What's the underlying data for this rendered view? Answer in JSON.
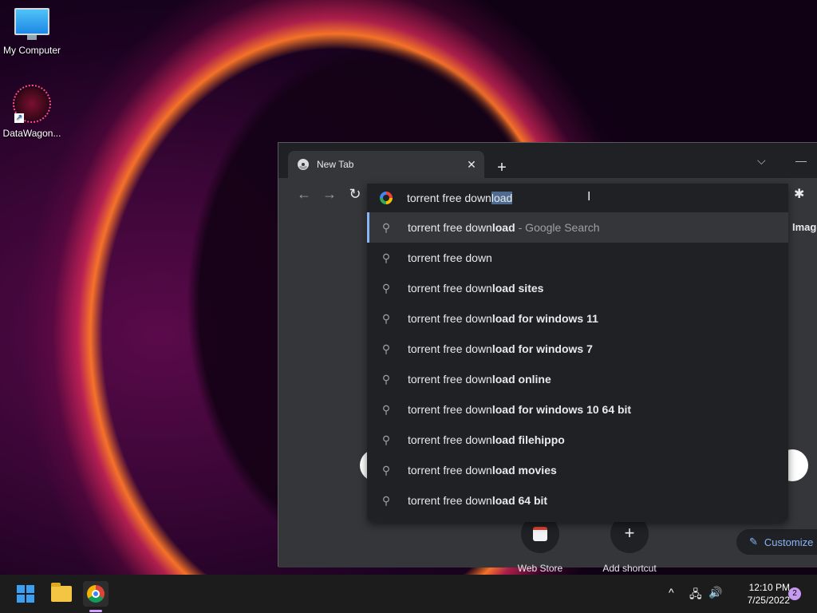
{
  "desktop": {
    "icons": [
      {
        "label": "My Computer"
      },
      {
        "label": "DataWagon..."
      }
    ]
  },
  "browser": {
    "tab": {
      "title": "New Tab",
      "close_glyph": "✕"
    },
    "new_tab_glyph": "+",
    "tab_search_glyph": "⌵",
    "minimize_glyph": "—",
    "nav": {
      "back": "←",
      "forward": "→",
      "reload": "↻"
    },
    "extension_glyph": "✱",
    "ntp": {
      "images_link": "Image",
      "shortcuts": [
        {
          "label": "Web Store"
        },
        {
          "label": "Add shortcut",
          "glyph": "+"
        }
      ],
      "customize_label": "Customize",
      "customize_glyph": "✎"
    }
  },
  "omnibox": {
    "typed": "torrent free down",
    "autocomplete": "load",
    "suggestions": [
      {
        "typed": "torrent free down",
        "completion": "load",
        "extra": "- Google Search",
        "active": true
      },
      {
        "typed": "torrent free down",
        "completion": "",
        "extra": ""
      },
      {
        "typed": "torrent free down",
        "completion": "load sites",
        "extra": ""
      },
      {
        "typed": "torrent free down",
        "completion": "load for windows 11",
        "extra": ""
      },
      {
        "typed": "torrent free down",
        "completion": "load for windows 7",
        "extra": ""
      },
      {
        "typed": "torrent free down",
        "completion": "load online",
        "extra": ""
      },
      {
        "typed": "torrent free down",
        "completion": "load for windows 10 64 bit",
        "extra": ""
      },
      {
        "typed": "torrent free down",
        "completion": "load filehippo",
        "extra": ""
      },
      {
        "typed": "torrent free down",
        "completion": "load movies",
        "extra": ""
      },
      {
        "typed": "torrent free down",
        "completion": "load 64 bit",
        "extra": ""
      }
    ]
  },
  "taskbar": {
    "tray": {
      "chevron": "^",
      "network": "🖧",
      "volume": "🔊"
    },
    "clock": {
      "time": "12:10 PM",
      "date": "7/25/2022"
    },
    "notifications": "2"
  },
  "colors": {
    "accent": "#8ab4f8",
    "chrome_dark": "#202124",
    "toolbar": "#35363a"
  }
}
